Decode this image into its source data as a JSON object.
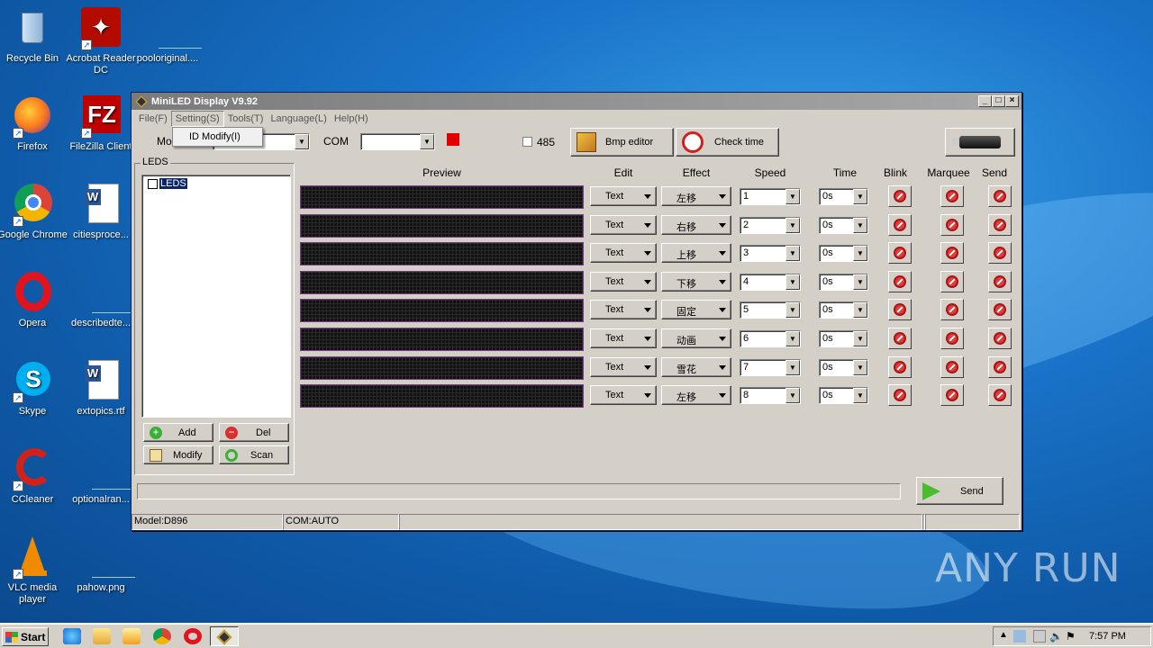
{
  "desktop": {
    "icons": [
      {
        "id": "recycle-bin",
        "label": "Recycle Bin"
      },
      {
        "id": "acrobat",
        "label": "Acrobat Reader DC"
      },
      {
        "id": "pooloriginal",
        "label": "pooloriginal...."
      },
      {
        "id": "firefox",
        "label": "Firefox"
      },
      {
        "id": "filezilla",
        "label": "FileZilla Client"
      },
      {
        "id": "chrome",
        "label": "Google Chrome"
      },
      {
        "id": "citiesproce",
        "label": "citiesproce..."
      },
      {
        "id": "opera",
        "label": "Opera"
      },
      {
        "id": "describedte",
        "label": "describedte..."
      },
      {
        "id": "skype",
        "label": "Skype"
      },
      {
        "id": "extopics",
        "label": "extopics.rtf"
      },
      {
        "id": "ccleaner",
        "label": "CCleaner"
      },
      {
        "id": "optionalran",
        "label": "optionalran..."
      },
      {
        "id": "vlc",
        "label": "VLC media player"
      },
      {
        "id": "pahow",
        "label": "pahow.png"
      }
    ],
    "watermark": "ANY RUN"
  },
  "window": {
    "title": "MiniLED Display V9.92",
    "menu": [
      "File(F)",
      "Setting(S)",
      "Tools(T)",
      "Language(L)",
      "Help(H)"
    ],
    "dropdown_item": "ID Modify(I)",
    "mode_label": "Mo",
    "com_label": "COM",
    "com_value": "",
    "rs485_label": "485",
    "bmp_editor": "Bmp editor",
    "check_time": "Check time",
    "leds_group": "LEDS",
    "leds_node": "LEDS",
    "add": "Add",
    "del": "Del",
    "modify": "Modify",
    "scan": "Scan",
    "headers": {
      "preview": "Preview",
      "edit": "Edit",
      "effect": "Effect",
      "speed": "Speed",
      "time": "Time",
      "blink": "Blink",
      "marquee": "Marquee",
      "send": "Send"
    },
    "rows": [
      {
        "edit": "Text",
        "effect": "左移",
        "speed": "1",
        "time": "0s"
      },
      {
        "edit": "Text",
        "effect": "右移",
        "speed": "2",
        "time": "0s"
      },
      {
        "edit": "Text",
        "effect": "上移",
        "speed": "3",
        "time": "0s"
      },
      {
        "edit": "Text",
        "effect": "下移",
        "speed": "4",
        "time": "0s"
      },
      {
        "edit": "Text",
        "effect": "固定",
        "speed": "5",
        "time": "0s"
      },
      {
        "edit": "Text",
        "effect": "动画",
        "speed": "6",
        "time": "0s"
      },
      {
        "edit": "Text",
        "effect": "雪花",
        "speed": "7",
        "time": "0s"
      },
      {
        "edit": "Text",
        "effect": "左移",
        "speed": "8",
        "time": "0s"
      }
    ],
    "send_button": "Send",
    "status": {
      "model": "Model:D896",
      "com": "COM:AUTO"
    },
    "colors": {
      "indicator": "#e00000"
    }
  },
  "taskbar": {
    "start": "Start",
    "clock": "7:57 PM"
  }
}
